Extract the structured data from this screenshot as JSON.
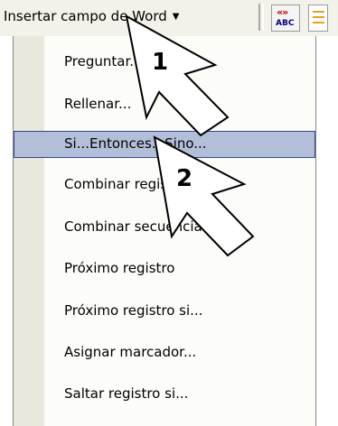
{
  "toolbar": {
    "insert_field_label": "Insertar campo de Word",
    "caret_icon": "dropdown-caret",
    "abc_icon_top": "«»",
    "abc_icon_bottom": "ABC"
  },
  "menu": {
    "items": [
      {
        "label": "Preguntar..."
      },
      {
        "label": "Rellenar..."
      },
      {
        "label": "Si...Entonces...Sino..."
      },
      {
        "label": "Combinar registro nº"
      },
      {
        "label": "Combinar secuencia nº"
      },
      {
        "label": "Próximo registro"
      },
      {
        "label": "Próximo registro si..."
      },
      {
        "label": "Asignar marcador..."
      },
      {
        "label": "Saltar registro si..."
      }
    ],
    "highlighted_index": 2
  },
  "callouts": [
    {
      "number": "1"
    },
    {
      "number": "2"
    }
  ],
  "colors": {
    "highlight_bg": "#b3bfd9",
    "highlight_border": "#2c4a8f",
    "gutter": "#eae8dc"
  }
}
